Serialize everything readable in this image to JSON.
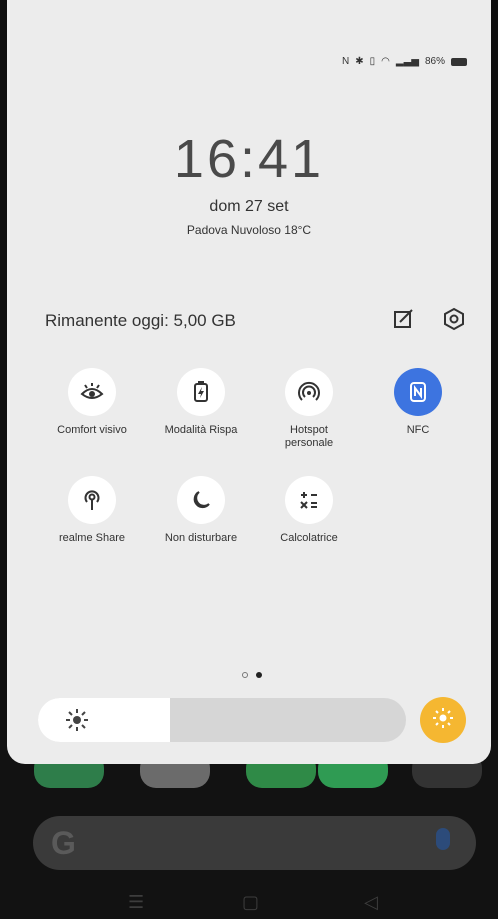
{
  "status_bar": {
    "battery": "86%"
  },
  "lockscreen": {
    "time": "16:41",
    "date": "dom 27 set",
    "weather": "Padova Nuvoloso 18°C"
  },
  "data_usage": {
    "label": "Rimanente oggi: 5,00 GB"
  },
  "tiles": [
    {
      "label": "Comfort visivo",
      "icon": "eye-comfort-icon",
      "active": false
    },
    {
      "label": "Modalità Rispa",
      "icon": "battery-saver-icon",
      "active": false
    },
    {
      "label": "Hotspot personale",
      "icon": "hotspot-icon",
      "active": false
    },
    {
      "label": "NFC",
      "icon": "nfc-icon",
      "active": true
    },
    {
      "label": "realme Share",
      "icon": "realme-share-icon",
      "active": false
    },
    {
      "label": "Non disturbare",
      "icon": "moon-icon",
      "active": false
    },
    {
      "label": "Calcolatrice",
      "icon": "calculator-icon",
      "active": false
    }
  ],
  "pager": {
    "pages": 2,
    "current": 2
  },
  "brightness": {
    "level": 0.36
  },
  "colors": {
    "panel": "#ececec",
    "accent": "#3d74e0",
    "auto_brightness": "#f5b731"
  },
  "home": {
    "search_logo": "G"
  }
}
